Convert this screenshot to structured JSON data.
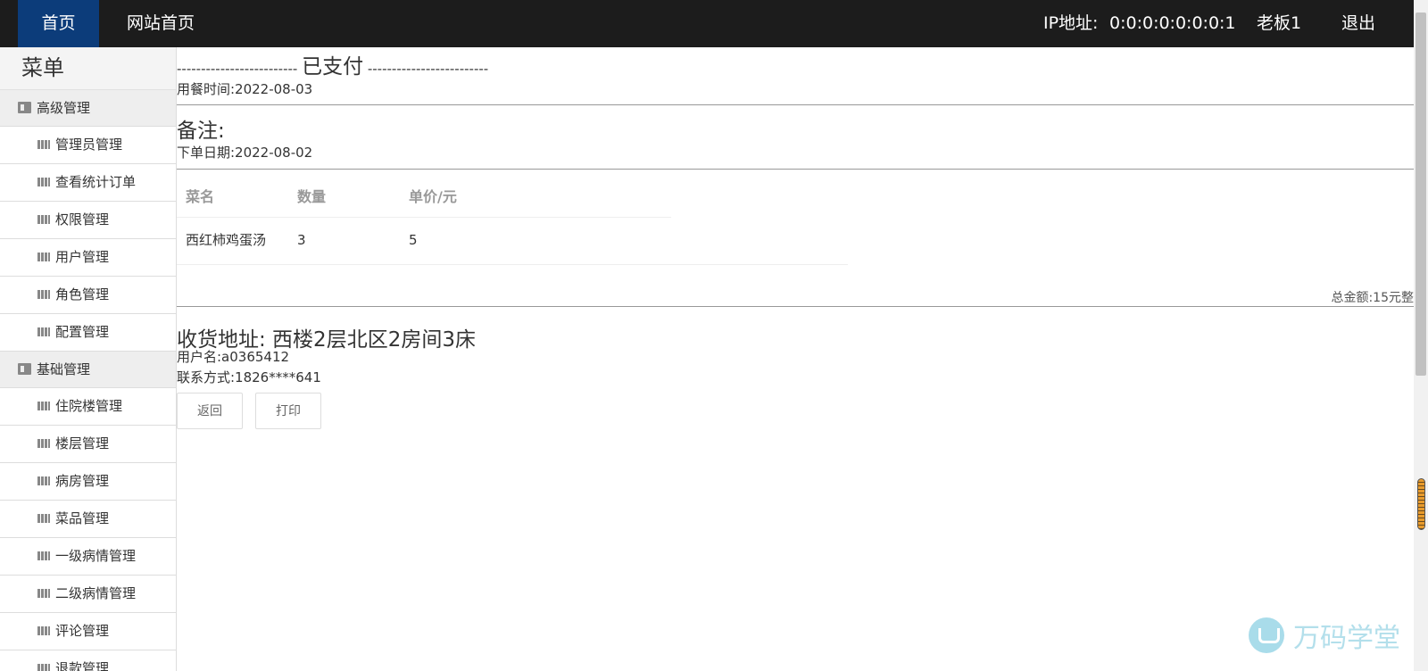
{
  "topbar": {
    "home": "首页",
    "site_home": "网站首页",
    "ip_label": "IP地址:",
    "ip_value": "0:0:0:0:0:0:0:1",
    "user": "老板1",
    "logout": "退出"
  },
  "sidebar": {
    "title": "菜单",
    "groups": [
      {
        "label": "高级管理",
        "items": [
          "管理员管理",
          "查看统计订单",
          "权限管理",
          "用户管理",
          "角色管理",
          "配置管理"
        ]
      },
      {
        "label": "基础管理",
        "items": [
          "住院楼管理",
          "楼层管理",
          "病房管理",
          "菜品管理",
          "一级病情管理",
          "二级病情管理",
          "评论管理",
          "退款管理"
        ]
      }
    ]
  },
  "order": {
    "status_dashes_left": "------------------------- ",
    "status": "已支付",
    "status_dashes_right": " -------------------------",
    "meal_time": "用餐时间:2022-08-03",
    "remark": "备注:",
    "order_date": "下单日期:2022-08-02",
    "table": {
      "headers": [
        "菜名",
        "数量",
        "单价/元"
      ],
      "rows": [
        [
          "西红柿鸡蛋汤",
          "3",
          "5"
        ]
      ]
    },
    "total": "总金额:15元整",
    "address": "收货地址: 西楼2层北区2房间3床",
    "username": "用户名:a0365412",
    "contact": "联系方式:1826****641",
    "back_button": "返回",
    "print_button": "打印"
  },
  "watermark": "万码学堂",
  "colors": {
    "topbar_bg": "#1c1c1c",
    "home_active_bg": "#0c3c7a",
    "watermark": "#b3dfeb"
  }
}
